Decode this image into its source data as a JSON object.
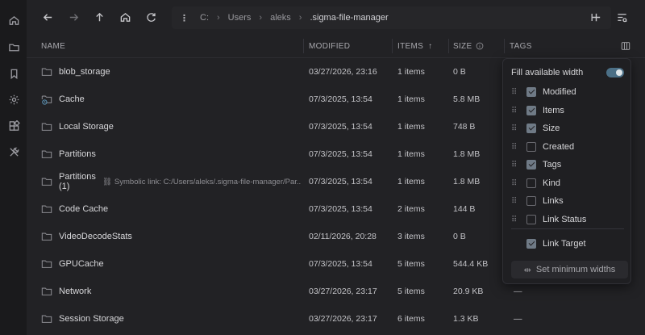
{
  "address": {
    "segments": [
      "C:",
      "Users",
      "aleks",
      ".sigma-file-manager"
    ],
    "separator": "›"
  },
  "columns": {
    "name": "NAME",
    "modified": "MODIFIED",
    "items": "ITEMS",
    "size": "SIZE",
    "tags": "TAGS"
  },
  "rows": [
    {
      "name": "blob_storage",
      "modified": "03/27/2026, 23:16",
      "items": "1 items",
      "size": "0 B",
      "tags": ""
    },
    {
      "name": "Cache",
      "modified": "07/3/2025, 13:54",
      "items": "1 items",
      "size": "5.8 MB",
      "tags": ""
    },
    {
      "name": "Local Storage",
      "modified": "07/3/2025, 13:54",
      "items": "1 items",
      "size": "748 B",
      "tags": ""
    },
    {
      "name": "Partitions",
      "modified": "07/3/2025, 13:54",
      "items": "1 items",
      "size": "1.8 MB",
      "tags": ""
    },
    {
      "name": "Partitions (1)",
      "symlink": "Symbolic link: C:/Users/aleks/.sigma-file-manager/Par...",
      "modified": "07/3/2025, 13:54",
      "items": "1 items",
      "size": "1.8 MB",
      "tags": ""
    },
    {
      "name": "Code Cache",
      "modified": "07/3/2025, 13:54",
      "items": "2 items",
      "size": "144 B",
      "tags": ""
    },
    {
      "name": "VideoDecodeStats",
      "modified": "02/11/2026, 20:28",
      "items": "3 items",
      "size": "0 B",
      "tags": ""
    },
    {
      "name": "GPUCache",
      "modified": "07/3/2025, 13:54",
      "items": "5 items",
      "size": "544.4 KB",
      "tags": ""
    },
    {
      "name": "Network",
      "modified": "03/27/2026, 23:17",
      "items": "5 items",
      "size": "20.9 KB",
      "tags": "—"
    },
    {
      "name": "Session Storage",
      "modified": "03/27/2026, 23:17",
      "items": "6 items",
      "size": "1.3 KB",
      "tags": "—"
    }
  ],
  "column_panel": {
    "fill_label": "Fill available width",
    "fill_on": true,
    "options": [
      {
        "label": "Modified",
        "checked": true
      },
      {
        "label": "Items",
        "checked": true
      },
      {
        "label": "Size",
        "checked": true
      },
      {
        "label": "Created",
        "checked": false
      },
      {
        "label": "Tags",
        "checked": true
      },
      {
        "label": "Kind",
        "checked": false
      },
      {
        "label": "Links",
        "checked": false
      },
      {
        "label": "Link Status",
        "checked": false
      }
    ],
    "extra_option": {
      "label": "Link Target",
      "checked": true
    },
    "min_width_button": "Set minimum widths"
  },
  "colors": {
    "accent": "#4b6f86",
    "background": "#222225",
    "sidebar": "#1a1a1c"
  }
}
